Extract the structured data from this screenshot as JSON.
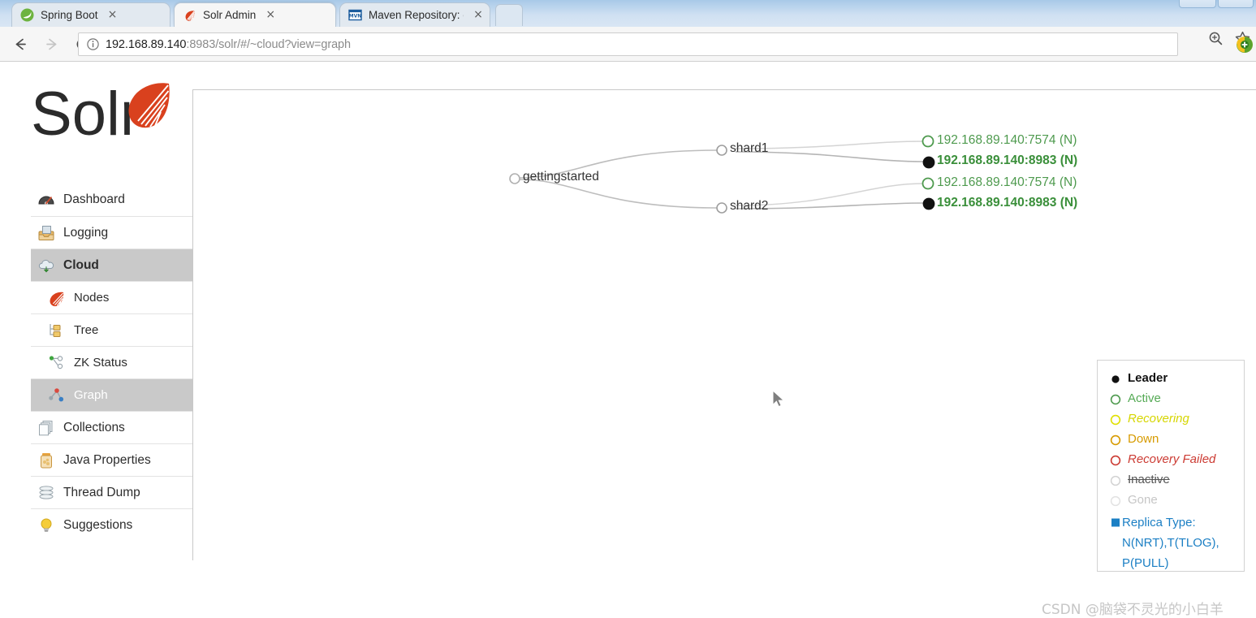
{
  "browser": {
    "tabs": [
      {
        "title": "Spring Boot",
        "favicon": "spring-leaf-icon",
        "active": false
      },
      {
        "title": "Solr Admin",
        "favicon": "solr-sunburst-icon",
        "active": true
      },
      {
        "title": "Maven Repository: org",
        "favicon": "maven-icon",
        "active": false
      }
    ],
    "close_glyph": "×",
    "nav": {
      "back": "back-arrow-icon",
      "forward": "forward-arrow-icon",
      "reload": "reload-icon"
    },
    "omnibox": {
      "info_icon": "page-info-icon",
      "url_host": "192.168.89.140",
      "url_path": ":8983/solr/#/~cloud?view=graph",
      "zoom_icon": "zoom-magnifier-icon",
      "bookmark_icon": "bookmark-star-icon",
      "extension_icon": "extension-icon"
    }
  },
  "sidebar": {
    "logo_text": "Solr",
    "items": [
      {
        "label": "Dashboard",
        "icon": "dashboard-gauge-icon",
        "level": "top",
        "state": "normal"
      },
      {
        "label": "Logging",
        "icon": "logging-tray-icon",
        "level": "top",
        "state": "normal"
      },
      {
        "label": "Cloud",
        "icon": "cloud-icon",
        "level": "top",
        "state": "active"
      },
      {
        "label": "Nodes",
        "icon": "nodes-sunburst-icon",
        "level": "sub",
        "state": "normal"
      },
      {
        "label": "Tree",
        "icon": "tree-icon",
        "level": "sub",
        "state": "normal"
      },
      {
        "label": "ZK Status",
        "icon": "zk-status-icon",
        "level": "sub",
        "state": "normal"
      },
      {
        "label": "Graph",
        "icon": "graph-icon",
        "level": "sub",
        "state": "active-sub"
      },
      {
        "label": "Collections",
        "icon": "collections-icon",
        "level": "top",
        "state": "normal"
      },
      {
        "label": "Java Properties",
        "icon": "java-properties-icon",
        "level": "top",
        "state": "normal"
      },
      {
        "label": "Thread Dump",
        "icon": "thread-dump-icon",
        "level": "top",
        "state": "normal"
      },
      {
        "label": "Suggestions",
        "icon": "suggestions-bulb-icon",
        "level": "top",
        "state": "normal"
      }
    ]
  },
  "graph": {
    "collection": {
      "label": "gettingstarted",
      "state": "plain"
    },
    "shards": [
      {
        "label": "shard1",
        "replicas": [
          {
            "label": "192.168.89.140:7574 (N)",
            "state": "active",
            "leader": false
          },
          {
            "label": "192.168.89.140:8983 (N)",
            "state": "leader",
            "leader": true
          }
        ]
      },
      {
        "label": "shard2",
        "replicas": [
          {
            "label": "192.168.89.140:7574 (N)",
            "state": "active",
            "leader": false
          },
          {
            "label": "192.168.89.140:8983 (N)",
            "state": "leader",
            "leader": true
          }
        ]
      }
    ]
  },
  "legend": {
    "rows": [
      {
        "label": "Leader",
        "marker": "filled-black-dot",
        "key": "leader"
      },
      {
        "label": "Active",
        "marker": "green-circle",
        "key": "active"
      },
      {
        "label": "Recovering",
        "marker": "yellow-circle",
        "key": "recovering"
      },
      {
        "label": "Down",
        "marker": "orange-circle",
        "key": "down"
      },
      {
        "label": "Recovery Failed",
        "marker": "red-circle",
        "key": "recovery-failed"
      },
      {
        "label": "Inactive",
        "marker": "gray-circle",
        "key": "inactive"
      },
      {
        "label": "Gone",
        "marker": "faint-gray-circle",
        "key": "gone"
      }
    ],
    "replica_type": {
      "marker": "blue-square",
      "line1": "Replica Type:",
      "line2": "N(NRT),T(TLOG),",
      "line3": "P(PULL)"
    }
  },
  "colors": {
    "leader": "#111111",
    "active": "#55aa55",
    "recovering": "#d6d600",
    "down": "#d79b00",
    "recovery_failed": "#cc3b33",
    "inactive": "#cccccc",
    "gone": "#e0e0e0",
    "replica_type": "#1b7fc4",
    "solr_orange": "#d9411e",
    "sidebar_active": "#c9c9c9"
  },
  "watermark": "CSDN @脑袋不灵光的小白羊"
}
